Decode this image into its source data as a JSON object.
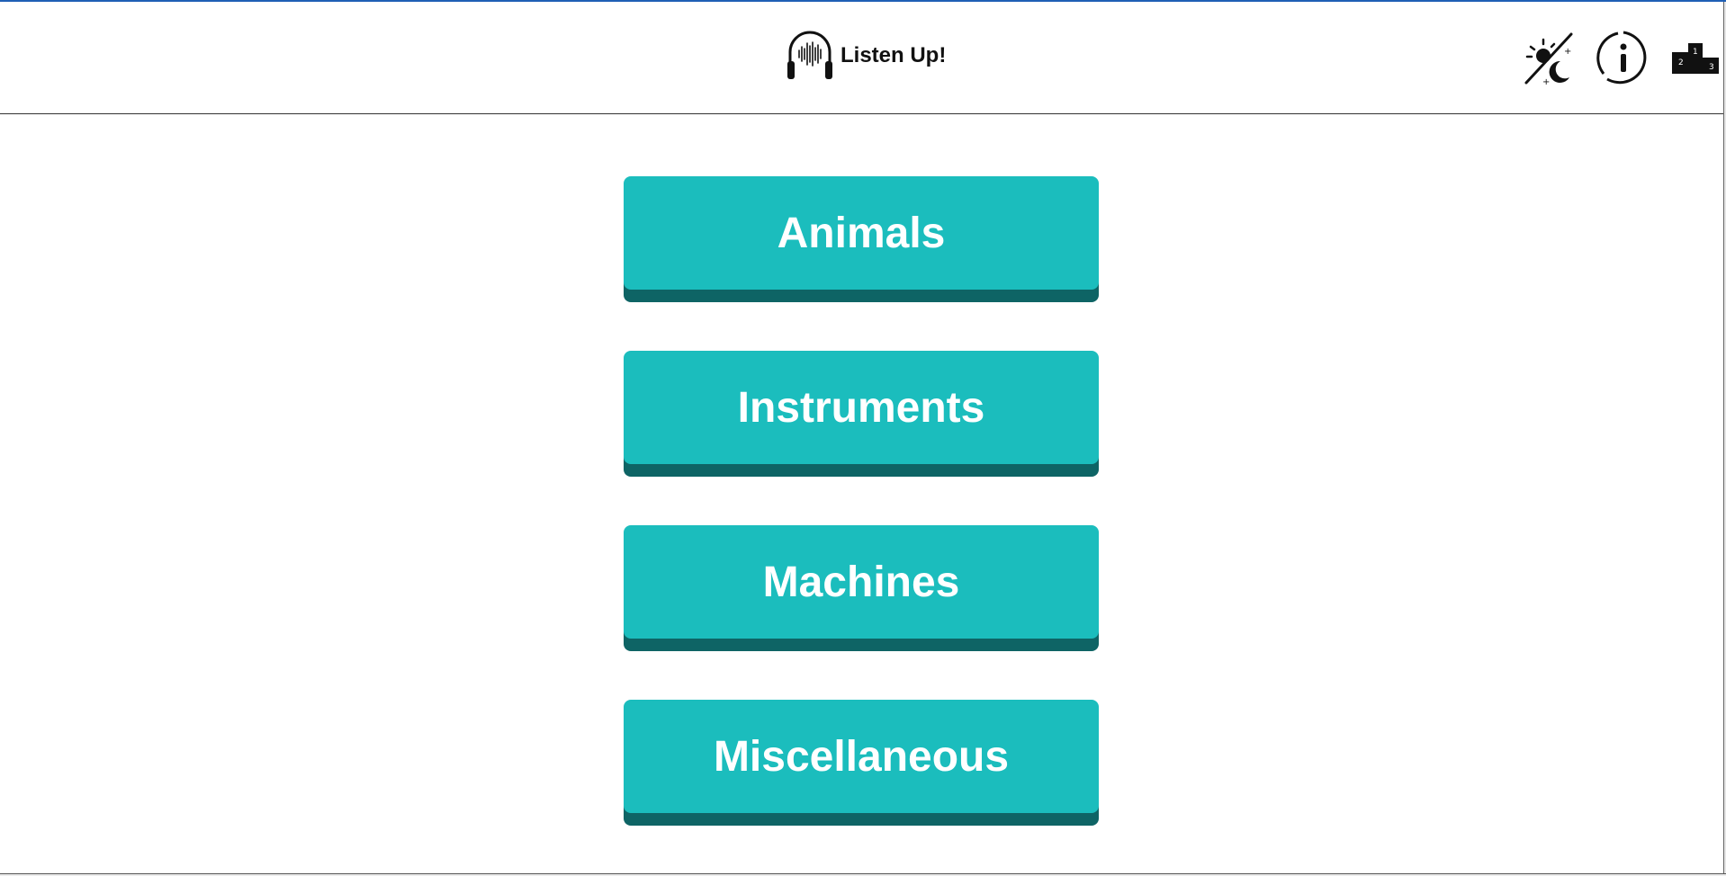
{
  "header": {
    "title": "Listen Up!",
    "logo_icon": "headphones-soundwave-icon",
    "actions": [
      {
        "name": "theme-toggle-button",
        "icon": "sun-moon-icon"
      },
      {
        "name": "info-button",
        "icon": "info-icon"
      },
      {
        "name": "leaderboard-button",
        "icon": "podium-icon",
        "podium_labels": [
          "2",
          "1",
          "3"
        ]
      }
    ]
  },
  "categories": [
    {
      "label": "Animals"
    },
    {
      "label": "Instruments"
    },
    {
      "label": "Machines"
    },
    {
      "label": "Miscellaneous"
    }
  ],
  "colors": {
    "button_face": "#1bbdbd",
    "button_shadow": "#0e6465",
    "button_text": "#ffffff",
    "top_accent": "#1f5fb5"
  }
}
